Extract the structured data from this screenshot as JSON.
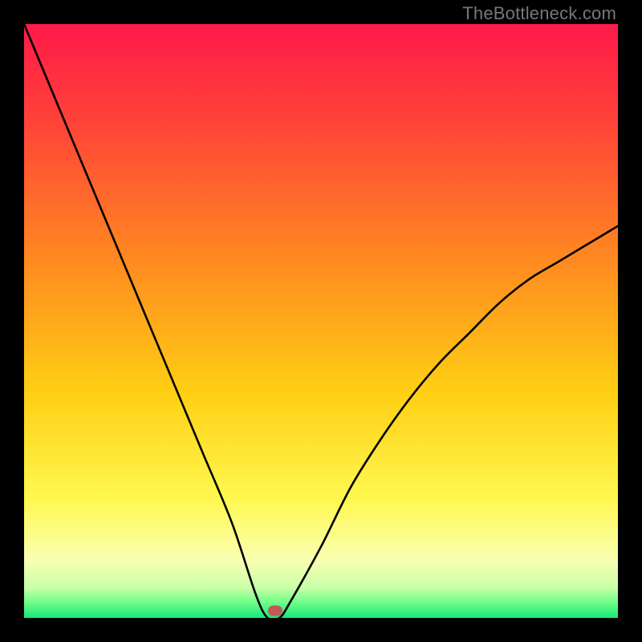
{
  "watermark": "TheBottleneck.com",
  "colors": {
    "frame": "#000000",
    "curve": "#000000",
    "marker": "#c05a56",
    "watermark": "#777777"
  },
  "marker": {
    "x_pct": 42.3,
    "y_pct": 98.8
  },
  "chart_data": {
    "type": "line",
    "title": "",
    "xlabel": "",
    "ylabel": "",
    "xlim": [
      0,
      100
    ],
    "ylim": [
      0,
      100
    ],
    "note": "V-shaped bottleneck curve. x = relative hardware parameter (0-100), y = bottleneck percentage (0 = no bottleneck / green band at bottom, 100 = severe bottleneck / red top). Background is a vertical red→yellow→green gradient encoding the y-axis severity. Minimum occurs near x≈42. A small red marker sits at the minimum.",
    "series": [
      {
        "name": "bottleneck-curve",
        "x": [
          0,
          5,
          10,
          15,
          20,
          25,
          30,
          35,
          39,
          41,
          43,
          45,
          50,
          55,
          60,
          65,
          70,
          75,
          80,
          85,
          90,
          95,
          100
        ],
        "y": [
          100,
          88,
          76,
          64,
          52,
          40,
          28,
          16,
          4,
          0,
          0,
          3,
          12,
          22,
          30,
          37,
          43,
          48,
          53,
          57,
          60,
          63,
          66
        ]
      }
    ],
    "gradient_stops": [
      {
        "pct": 0,
        "color": "#ff1a4a"
      },
      {
        "pct": 15,
        "color": "#ff3f3a"
      },
      {
        "pct": 40,
        "color": "#ff8a20"
      },
      {
        "pct": 62,
        "color": "#ffcf14"
      },
      {
        "pct": 80,
        "color": "#fff850"
      },
      {
        "pct": 90,
        "color": "#fbffb0"
      },
      {
        "pct": 95,
        "color": "#c8ffa8"
      },
      {
        "pct": 97,
        "color": "#7cff8c"
      },
      {
        "pct": 100,
        "color": "#18e878"
      }
    ]
  }
}
